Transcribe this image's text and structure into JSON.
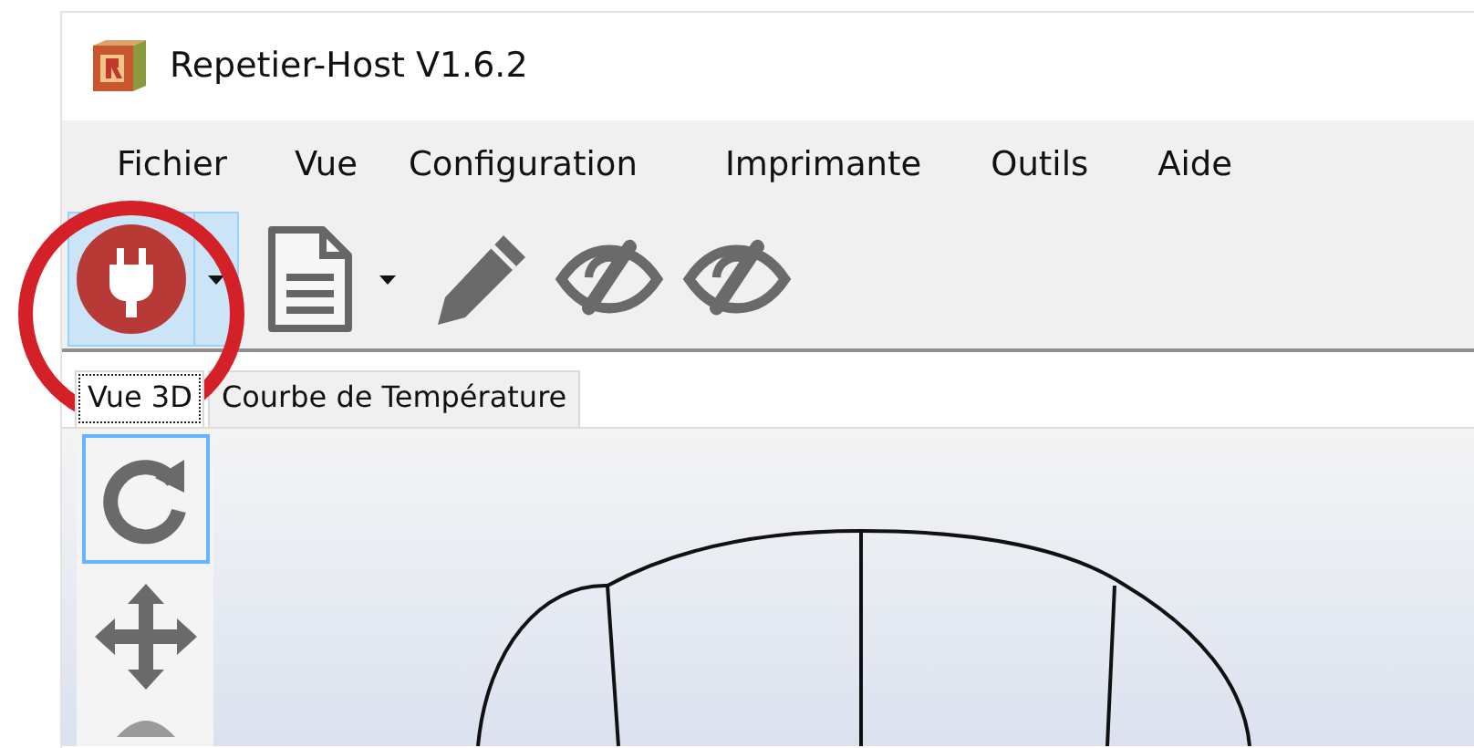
{
  "window": {
    "title": "Repetier-Host V1.6.2"
  },
  "menu": [
    "Fichier",
    "Vue",
    "Configuration",
    "Imprimante",
    "Outils",
    "Aide"
  ],
  "toolbar": [
    {
      "kind": "connect",
      "dropdown": true,
      "highlighted": true
    },
    {
      "kind": "document",
      "dropdown": true,
      "highlighted": false
    },
    {
      "kind": "pencil",
      "dropdown": false,
      "highlighted": false
    },
    {
      "kind": "eye-off",
      "dropdown": false,
      "highlighted": false
    },
    {
      "kind": "eye-off",
      "dropdown": false,
      "highlighted": false
    }
  ],
  "tabs": [
    {
      "label": "Vue 3D",
      "selected": true
    },
    {
      "label": "Courbe de Température",
      "selected": false
    }
  ],
  "view_tools": [
    {
      "kind": "rotate",
      "selected": true
    },
    {
      "kind": "move",
      "selected": false
    },
    {
      "kind": "partial",
      "selected": false
    }
  ],
  "annotation": {
    "kind": "circle"
  }
}
